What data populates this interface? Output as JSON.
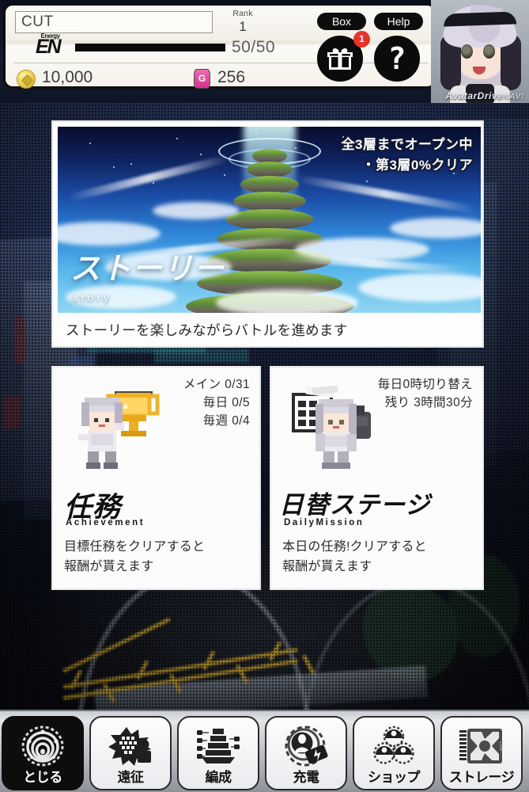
{
  "header": {
    "player_name": "CUT",
    "rank_label": "Rank",
    "rank_value": "1",
    "energy_small_label": "Energy",
    "energy_label": "EN",
    "energy_text": "50/50",
    "energy_current": 50,
    "energy_max": 50,
    "coin_value": "10,000",
    "gem_value": "256",
    "gem_glyph": "G",
    "box_button": "Box",
    "help_button": "Help",
    "gift_badge_count": "1",
    "help_glyph": "?",
    "navi_brand": "AvatarDrive",
    "navi_suffix": "NAVI"
  },
  "story": {
    "overlay_line1": "全3層までオープン中",
    "overlay_line2": "・第3層0%クリア",
    "title": "ストーリー",
    "subtitle": "story",
    "description": "ストーリーを楽しみながらバトルを進めます"
  },
  "cards": [
    {
      "stat1": "メイン 0/31",
      "stat2": "毎日 0/5",
      "stat3": "毎週 0/4",
      "title": "任務",
      "subtitle": "Achievement",
      "desc1": "目標任務をクリアすると",
      "desc2": "報酬が貰えます"
    },
    {
      "stat1": "毎日0時切り替え",
      "stat2": "残り 3時間30分",
      "stat3": "",
      "title": "日替ステージ",
      "subtitle": "DailyMission",
      "desc1": "本日の任務!クリアすると",
      "desc2": "報酬が貰えます"
    }
  ],
  "nav": {
    "items": [
      {
        "label": "とじる",
        "icon": "close-spiral-icon",
        "active": true
      },
      {
        "label": "遠征",
        "icon": "expedition-burst-icon",
        "active": false
      },
      {
        "label": "編成",
        "icon": "formation-tower-icon",
        "active": false
      },
      {
        "label": "充電",
        "icon": "charge-battery-icon",
        "active": false
      },
      {
        "label": "ショップ",
        "icon": "shop-capsules-icon",
        "active": false
      },
      {
        "label": "ストレージ",
        "icon": "storage-item-icon",
        "active": false
      }
    ]
  },
  "colors": {
    "accent_red": "#e8332a",
    "coin_gold": "#e9cf4d",
    "gem_pink": "#d62f8c",
    "panel_cream": "#f5f2ea",
    "nav_dark": "#0d0d0d",
    "sky_blue": "#2f86d8"
  }
}
